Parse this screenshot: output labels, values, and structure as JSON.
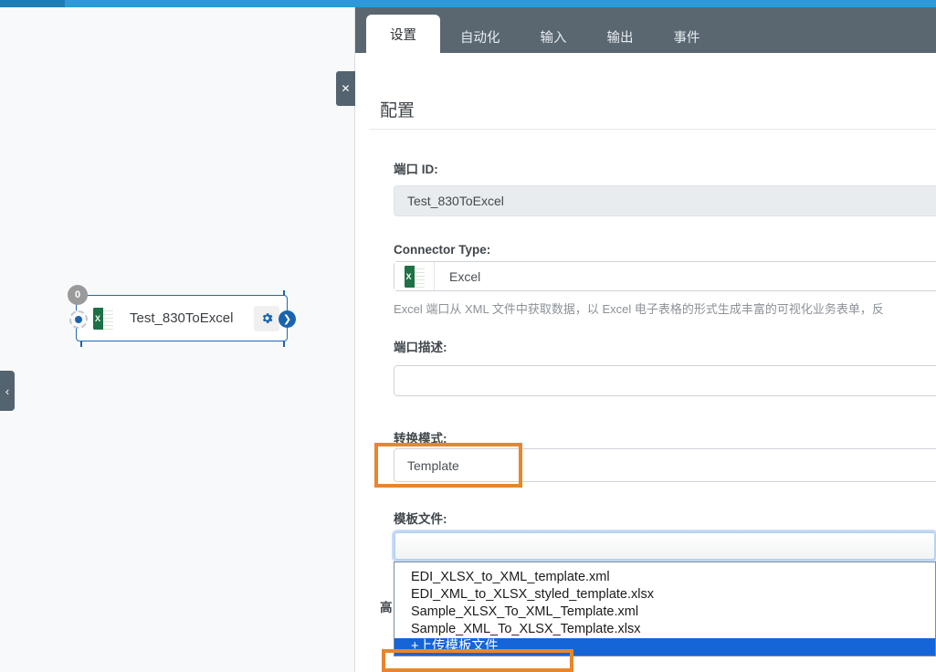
{
  "topbar": {
    "accent": "#2b9ad9",
    "accent_dark": "#1d7eb5"
  },
  "canvas": {
    "collapse_handle": "‹",
    "node": {
      "badge": "0",
      "label": "Test_830ToExcel",
      "icon": "excel-icon",
      "gear": "⚙",
      "out_arrow": "❯"
    }
  },
  "panel": {
    "close_label": "✕",
    "tabs": [
      {
        "label": "设置",
        "active": true
      },
      {
        "label": "自动化",
        "active": false
      },
      {
        "label": "输入",
        "active": false
      },
      {
        "label": "输出",
        "active": false
      },
      {
        "label": "事件",
        "active": false
      }
    ],
    "section_title": "配置",
    "fields": {
      "port_id_label": "端口 ID:",
      "port_id_value": "Test_830ToExcel",
      "connector_type_label": "Connector Type:",
      "connector_type_value": "Excel",
      "connector_help": "Excel 端口从 XML 文件中获取数据，以 Excel 电子表格的形式生成丰富的可视化业务表单，反",
      "port_desc_label": "端口描述:",
      "port_desc_value": "",
      "transform_mode_label": "转换模式:",
      "transform_mode_value": "Template",
      "template_file_label": "模板文件:",
      "template_file_value": "",
      "advanced_label": "高"
    },
    "dropdown": {
      "options": [
        {
          "label": "EDI_XLSX_to_XML_template.xml",
          "selected": false
        },
        {
          "label": "EDI_XML_to_XLSX_styled_template.xlsx",
          "selected": false
        },
        {
          "label": "Sample_XLSX_To_XML_Template.xml",
          "selected": false
        },
        {
          "label": "Sample_XML_To_XLSX_Template.xlsx",
          "selected": false
        },
        {
          "label": "+上传模板文件",
          "selected": true
        }
      ]
    }
  },
  "highlight_color": "#e8862a"
}
